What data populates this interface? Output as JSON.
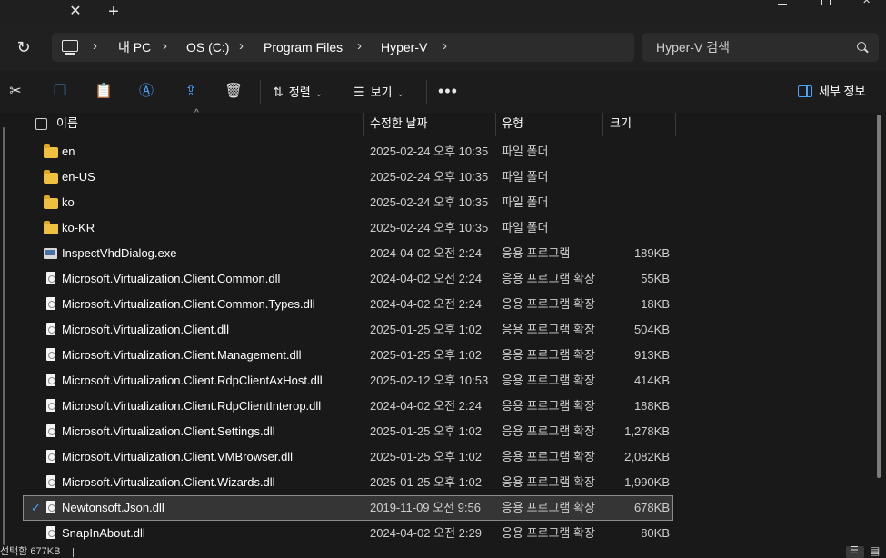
{
  "tabbar": {
    "close_glyph": "✕",
    "new_tab_glyph": "+"
  },
  "nav": {
    "refresh_glyph": "↻",
    "breadcrumb": [
      "내 PC",
      "OS (C:)",
      "Program Files",
      "Hyper-V"
    ],
    "chevron": "›",
    "search_placeholder": "Hyper-V 검색"
  },
  "toolbar": {
    "cut_glyph": "✂",
    "copy_glyph": "❐",
    "paste_glyph": "📋",
    "rename_glyph": "Ⓐ",
    "share_glyph": "⇪",
    "delete_glyph": "🗑",
    "sort_label": "정렬",
    "sort_glyph": "⇅",
    "view_label": "보기",
    "view_glyph": "☰",
    "dropdown_glyph": "⌄",
    "more_label": "•••",
    "details_label": "세부 정보"
  },
  "columns": {
    "name": "이름",
    "modified": "수정한 날짜",
    "type": "유형",
    "size": "크기",
    "sort_caret": "^"
  },
  "files": [
    {
      "name": "en",
      "icon": "folder-icon",
      "modified": "2025-02-24 오후 10:35",
      "type": "파일 폴더",
      "size": ""
    },
    {
      "name": "en-US",
      "icon": "folder-icon",
      "modified": "2025-02-24 오후 10:35",
      "type": "파일 폴더",
      "size": ""
    },
    {
      "name": "ko",
      "icon": "folder-icon",
      "modified": "2025-02-24 오후 10:35",
      "type": "파일 폴더",
      "size": ""
    },
    {
      "name": "ko-KR",
      "icon": "folder-icon",
      "modified": "2025-02-24 오후 10:35",
      "type": "파일 폴더",
      "size": ""
    },
    {
      "name": "InspectVhdDialog.exe",
      "icon": "exe-icon",
      "modified": "2024-04-02 오전 2:24",
      "type": "응용 프로그램",
      "size": "189KB"
    },
    {
      "name": "Microsoft.Virtualization.Client.Common.dll",
      "icon": "dll-icon",
      "modified": "2024-04-02 오전 2:24",
      "type": "응용 프로그램 확장",
      "size": "55KB"
    },
    {
      "name": "Microsoft.Virtualization.Client.Common.Types.dll",
      "icon": "dll-icon",
      "modified": "2024-04-02 오전 2:24",
      "type": "응용 프로그램 확장",
      "size": "18KB"
    },
    {
      "name": "Microsoft.Virtualization.Client.dll",
      "icon": "dll-icon",
      "modified": "2025-01-25 오후 1:02",
      "type": "응용 프로그램 확장",
      "size": "504KB"
    },
    {
      "name": "Microsoft.Virtualization.Client.Management.dll",
      "icon": "dll-icon",
      "modified": "2025-01-25 오후 1:02",
      "type": "응용 프로그램 확장",
      "size": "913KB"
    },
    {
      "name": "Microsoft.Virtualization.Client.RdpClientAxHost.dll",
      "icon": "dll-icon",
      "modified": "2025-02-12 오후 10:53",
      "type": "응용 프로그램 확장",
      "size": "414KB"
    },
    {
      "name": "Microsoft.Virtualization.Client.RdpClientInterop.dll",
      "icon": "dll-icon",
      "modified": "2024-04-02 오전 2:24",
      "type": "응용 프로그램 확장",
      "size": "188KB"
    },
    {
      "name": "Microsoft.Virtualization.Client.Settings.dll",
      "icon": "dll-icon",
      "modified": "2025-01-25 오후 1:02",
      "type": "응용 프로그램 확장",
      "size": "1,278KB"
    },
    {
      "name": "Microsoft.Virtualization.Client.VMBrowser.dll",
      "icon": "dll-icon",
      "modified": "2025-01-25 오후 1:02",
      "type": "응용 프로그램 확장",
      "size": "2,082KB"
    },
    {
      "name": "Microsoft.Virtualization.Client.Wizards.dll",
      "icon": "dll-icon",
      "modified": "2025-01-25 오후 1:02",
      "type": "응용 프로그램 확장",
      "size": "1,990KB"
    },
    {
      "name": "Newtonsoft.Json.dll",
      "icon": "dll-icon",
      "modified": "2019-11-09 오전 9:56",
      "type": "응용 프로그램 확장",
      "size": "678KB",
      "selected": true
    },
    {
      "name": "SnapInAbout.dll",
      "icon": "dll-icon",
      "modified": "2024-04-02 오전 2:29",
      "type": "응용 프로그램 확장",
      "size": "80KB"
    }
  ],
  "status": {
    "text": "선택함 677KB",
    "check_glyph": "✓"
  },
  "colors": {
    "accent": "#4aa3ff",
    "background": "#191919",
    "folder": "#f0c040"
  }
}
